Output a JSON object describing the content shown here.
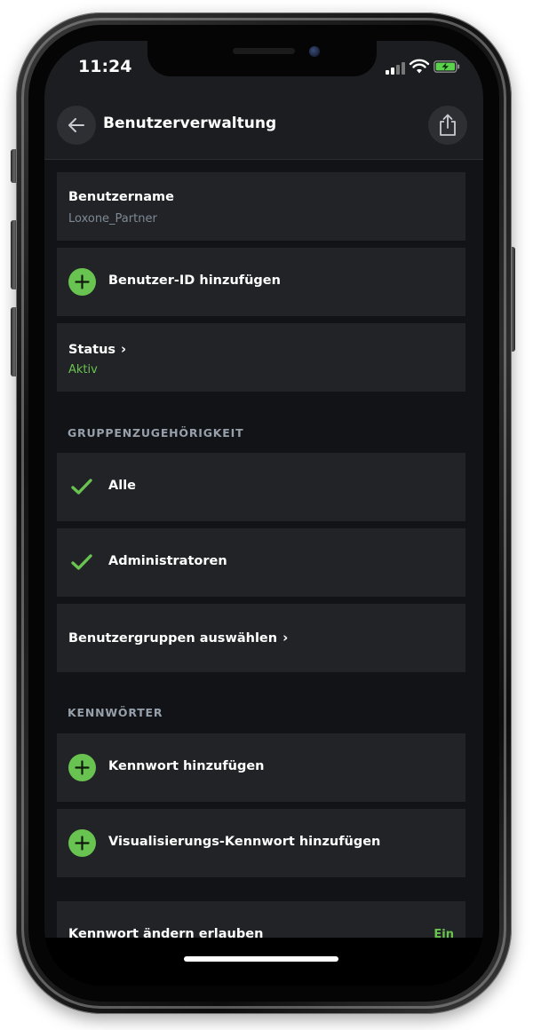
{
  "status_bar": {
    "time": "11:24",
    "icons": [
      "signal-icon",
      "wifi-icon",
      "battery-charging-icon"
    ]
  },
  "header": {
    "title": "Benutzerverwaltung",
    "back_icon": "arrow-left-icon",
    "share_icon": "share-icon"
  },
  "user": {
    "username_label": "Benutzername",
    "username_value": "Loxone_Partner",
    "add_user_id": "Benutzer-ID hinzufügen",
    "status_label": "Status",
    "status_value": "Aktiv"
  },
  "groups": {
    "section_title": "GRUPPENZUGEHÖRIGKEIT",
    "items": [
      {
        "label": "Alle",
        "checked": true
      },
      {
        "label": "Administratoren",
        "checked": true
      }
    ],
    "select_label": "Benutzergruppen auswählen"
  },
  "passwords": {
    "section_title": "KENNWÖRTER",
    "add_password": "Kennwort hinzufügen",
    "add_visu_password": "Visualisierungs-Kennwort hinzufügen",
    "allow_change_label": "Kennwort ändern erlauben",
    "allow_change_value": "Ein"
  },
  "colors": {
    "accent_green": "#69c350",
    "card_bg": "#222326",
    "page_bg": "#121316"
  }
}
